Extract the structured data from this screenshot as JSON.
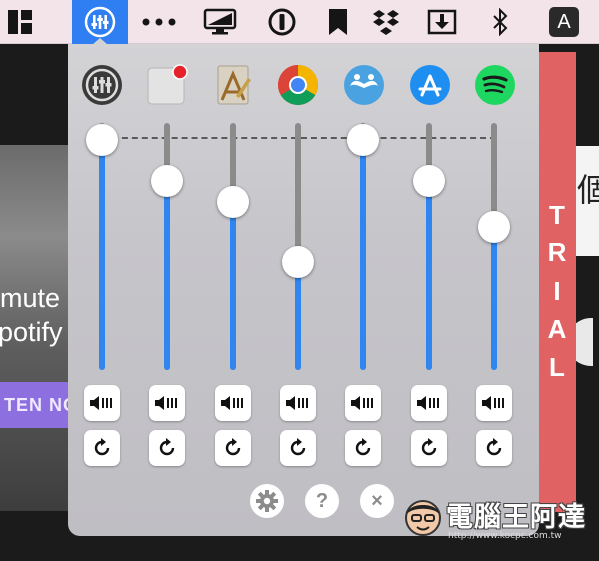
{
  "menubar": {
    "items": [
      {
        "name": "dashboard-icon"
      },
      {
        "name": "volume-mixer-icon",
        "active": true
      },
      {
        "name": "more-dots-icon"
      },
      {
        "name": "display-icon"
      },
      {
        "name": "one-password-icon"
      },
      {
        "name": "bookmark-icon"
      },
      {
        "name": "dropbox-icon"
      },
      {
        "name": "download-icon"
      },
      {
        "name": "bluetooth-icon"
      },
      {
        "name": "input-source-icon",
        "label": "A"
      }
    ],
    "accent": "#2f7ef2"
  },
  "background": {
    "left_text_line1": "mute",
    "left_text_line2": "potify",
    "left_button": "TEN NO",
    "right_char": "個"
  },
  "trial_banner": {
    "letters": [
      "T",
      "R",
      "I",
      "A",
      "L"
    ],
    "color": "#e06262"
  },
  "mixer": {
    "accent": "#2f86f1",
    "channels": [
      {
        "app": "Master volume",
        "icon": "master-volume-icon",
        "level": 1.0
      },
      {
        "app": "Notification app",
        "icon": "notification-app-icon",
        "level": 0.82
      },
      {
        "app": "Script Editor",
        "icon": "script-editor-icon",
        "level": 0.73
      },
      {
        "app": "Google Chrome",
        "icon": "chrome-icon",
        "level": 0.47
      },
      {
        "app": "Moustache app",
        "icon": "moustache-app-icon",
        "level": 1.0
      },
      {
        "app": "App Store",
        "icon": "app-store-icon",
        "level": 0.82
      },
      {
        "app": "Spotify",
        "icon": "spotify-icon",
        "level": 0.62
      }
    ],
    "footer": {
      "settings": "gear-icon",
      "help": "?",
      "close": "×"
    }
  },
  "watermark": {
    "text": "電腦王阿達",
    "url": "http://www.kocpc.com.tw"
  }
}
